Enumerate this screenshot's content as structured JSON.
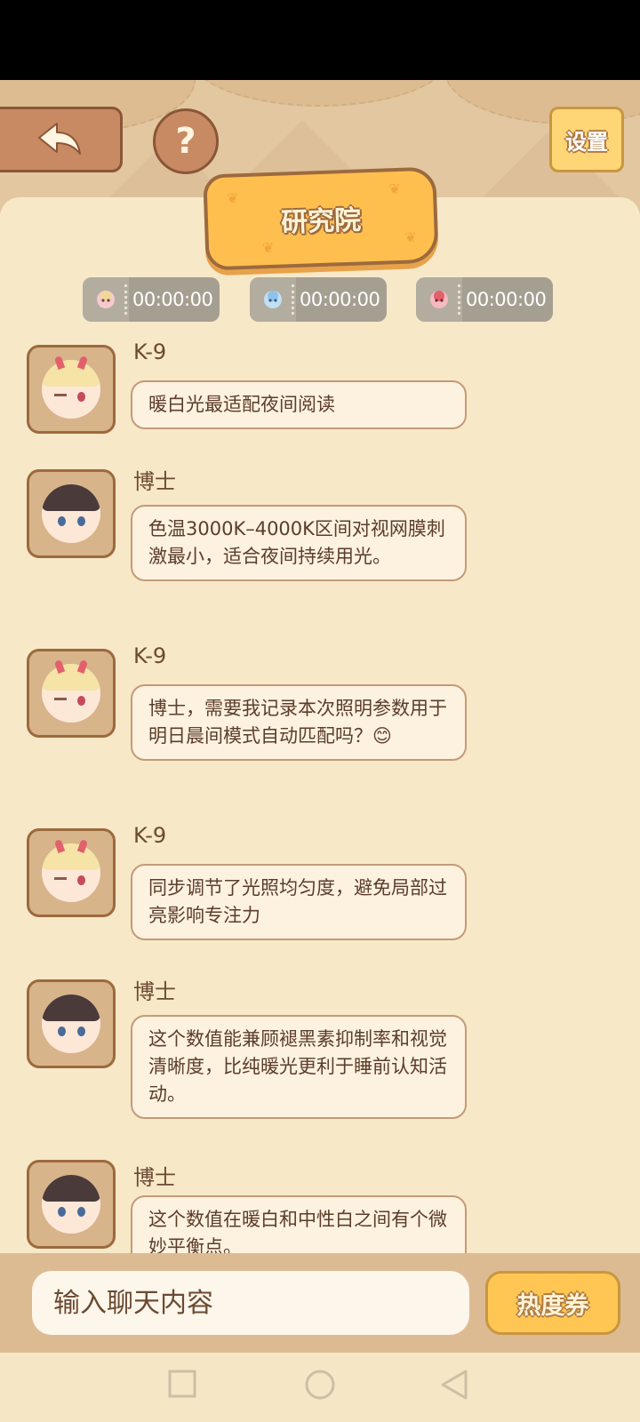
{
  "header": {
    "title": "研究院",
    "settings_label": "设置",
    "help_label": "?"
  },
  "timers": [
    {
      "time": "00:00:00"
    },
    {
      "time": "00:00:00"
    },
    {
      "time": "00:00:00"
    }
  ],
  "messages": [
    {
      "sender": "K-9",
      "text": "暖白光最适配夜间阅读"
    },
    {
      "sender": "博士",
      "text": "色温3000K–4000K区间对视网膜刺激最小，适合夜间持续用光。"
    },
    {
      "sender": "K-9",
      "text": "博士，需要我记录本次照明参数用于明日晨间模式自动匹配吗？😊"
    },
    {
      "sender": "K-9",
      "text": "同步调节了光照均匀度，避免局部过亮影响专注力"
    },
    {
      "sender": "博士",
      "text": "这个数值能兼顾褪黑素抑制率和视觉清晰度，比纯暖光更利于睡前认知活动。"
    },
    {
      "sender": "博士",
      "text": "这个数值在暖白和中性白之间有个微妙平衡点。"
    }
  ],
  "input": {
    "placeholder": "输入聊天内容",
    "heat_ticket_label": "热度券"
  },
  "colors": {
    "accent": "#ffc653",
    "panel": "#f7e8c8",
    "brown": "#9c6a3e"
  }
}
